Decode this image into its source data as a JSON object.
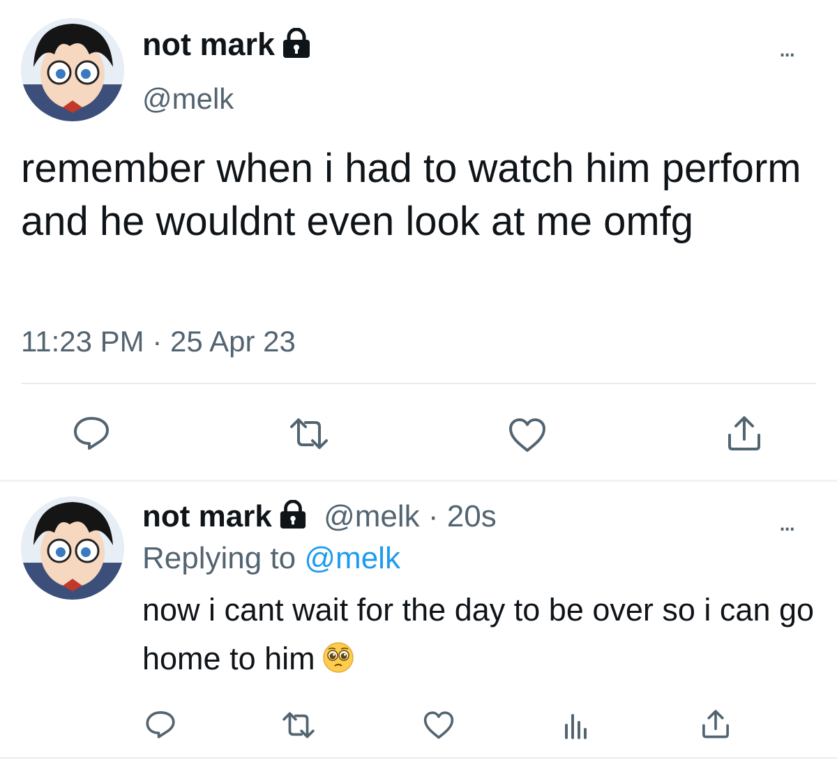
{
  "main_tweet": {
    "author_name": "not mark",
    "handle": "@melk",
    "text": "remember when i had to watch him perform and he wouldnt even look at me omfg",
    "time": "11:23 PM",
    "separator": "·",
    "date": "25 Apr 23",
    "more_label": "..."
  },
  "reply_tweet": {
    "author_name": "not mark",
    "handle": "@melk",
    "separator": "·",
    "age": "20s",
    "replying_to_label": "Replying to",
    "replying_to_handle": "@melk",
    "text": "now i cant wait for the day to be over so i can go home to him",
    "more_label": "..."
  },
  "icons": {
    "lock": "lock-icon",
    "reply": "reply-icon",
    "retweet": "retweet-icon",
    "like": "heart-icon",
    "share": "share-icon",
    "analytics": "analytics-icon",
    "emoji": "pleading-face-emoji"
  },
  "colors": {
    "text": "#0f1419",
    "muted": "#536471",
    "link": "#1d9bf0",
    "divider": "#e6ecf0"
  }
}
